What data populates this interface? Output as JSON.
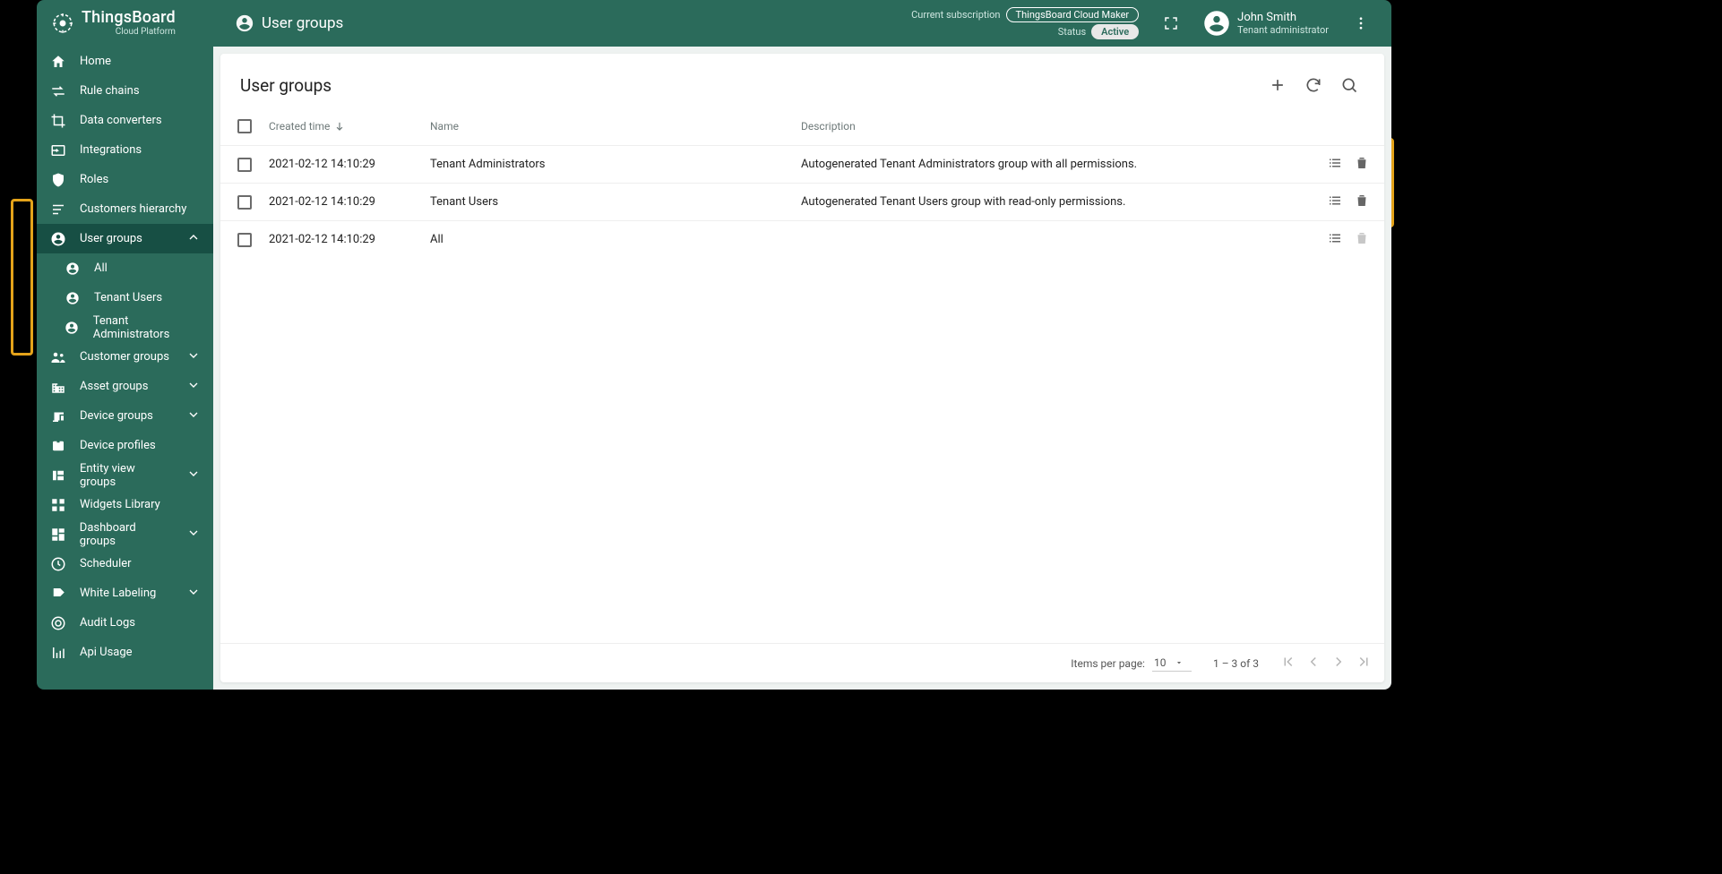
{
  "brand": {
    "title": "ThingsBoard",
    "subtitle": "Cloud Platform"
  },
  "header": {
    "page_icon": "account-circle-icon",
    "page_title": "User groups",
    "subscription_label": "Current subscription",
    "subscription_value": "ThingsBoard Cloud Maker",
    "status_label": "Status",
    "status_value": "Active",
    "user_name": "John Smith",
    "user_role": "Tenant administrator"
  },
  "sidebar": {
    "items": [
      {
        "label": "Home"
      },
      {
        "label": "Rule chains"
      },
      {
        "label": "Data converters"
      },
      {
        "label": "Integrations"
      },
      {
        "label": "Roles"
      },
      {
        "label": "Customers hierarchy"
      },
      {
        "label": "User groups"
      },
      {
        "label": "Customer groups"
      },
      {
        "label": "Asset groups"
      },
      {
        "label": "Device groups"
      },
      {
        "label": "Device profiles"
      },
      {
        "label": "Entity view groups"
      },
      {
        "label": "Widgets Library"
      },
      {
        "label": "Dashboard groups"
      },
      {
        "label": "Scheduler"
      },
      {
        "label": "White Labeling"
      },
      {
        "label": "Audit Logs"
      },
      {
        "label": "Api Usage"
      }
    ],
    "user_groups_children": [
      {
        "label": "All"
      },
      {
        "label": "Tenant Users"
      },
      {
        "label": "Tenant Administrators"
      }
    ]
  },
  "table": {
    "title": "User groups",
    "columns": {
      "created": "Created time",
      "name": "Name",
      "description": "Description"
    },
    "rows": [
      {
        "created": "2021-02-12 14:10:29",
        "name": "Tenant Administrators",
        "description": "Autogenerated Tenant Administrators group with all permissions.",
        "delete_enabled": true
      },
      {
        "created": "2021-02-12 14:10:29",
        "name": "Tenant Users",
        "description": "Autogenerated Tenant Users group with read-only permissions.",
        "delete_enabled": true
      },
      {
        "created": "2021-02-12 14:10:29",
        "name": "All",
        "description": "",
        "delete_enabled": false
      }
    ]
  },
  "pager": {
    "label": "Items per page:",
    "size": "10",
    "range": "1 – 3 of 3"
  }
}
